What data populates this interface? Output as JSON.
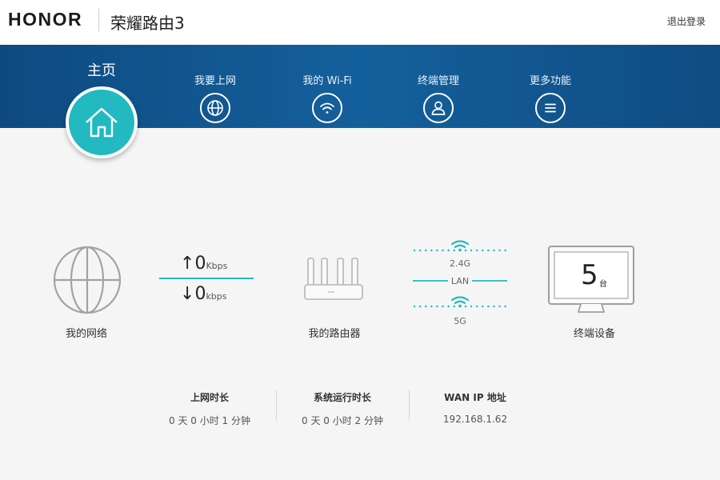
{
  "header": {
    "brand": "HONOR",
    "product": "荣耀路由3",
    "logout_label": "退出登录"
  },
  "nav": {
    "home_label": "主页",
    "items": [
      {
        "label": "我要上网",
        "icon": "globe-icon"
      },
      {
        "label": "我的 Wi-Fi",
        "icon": "wifi-icon"
      },
      {
        "label": "终端管理",
        "icon": "user-icon"
      },
      {
        "label": "更多功能",
        "icon": "menu-icon"
      }
    ]
  },
  "diagram": {
    "network_label": "我的网络",
    "upload_value": "0",
    "upload_unit": "Kbps",
    "download_value": "0",
    "download_unit": "kbps",
    "router_label": "我的路由器",
    "band_24": "2.4G",
    "band_lan": "LAN",
    "band_5g": "5G",
    "devices_label": "终端设备",
    "device_count": "5",
    "device_unit": "台"
  },
  "stats": [
    {
      "title": "上网时长",
      "value": "0 天 0 小时 1 分钟"
    },
    {
      "title": "系统运行时长",
      "value": "0 天 0 小时 2 分钟"
    },
    {
      "title": "WAN IP 地址",
      "value": "192.168.1.62"
    }
  ],
  "colors": {
    "accent_teal": "#22b9c1",
    "nav_blue": "#14609c"
  }
}
